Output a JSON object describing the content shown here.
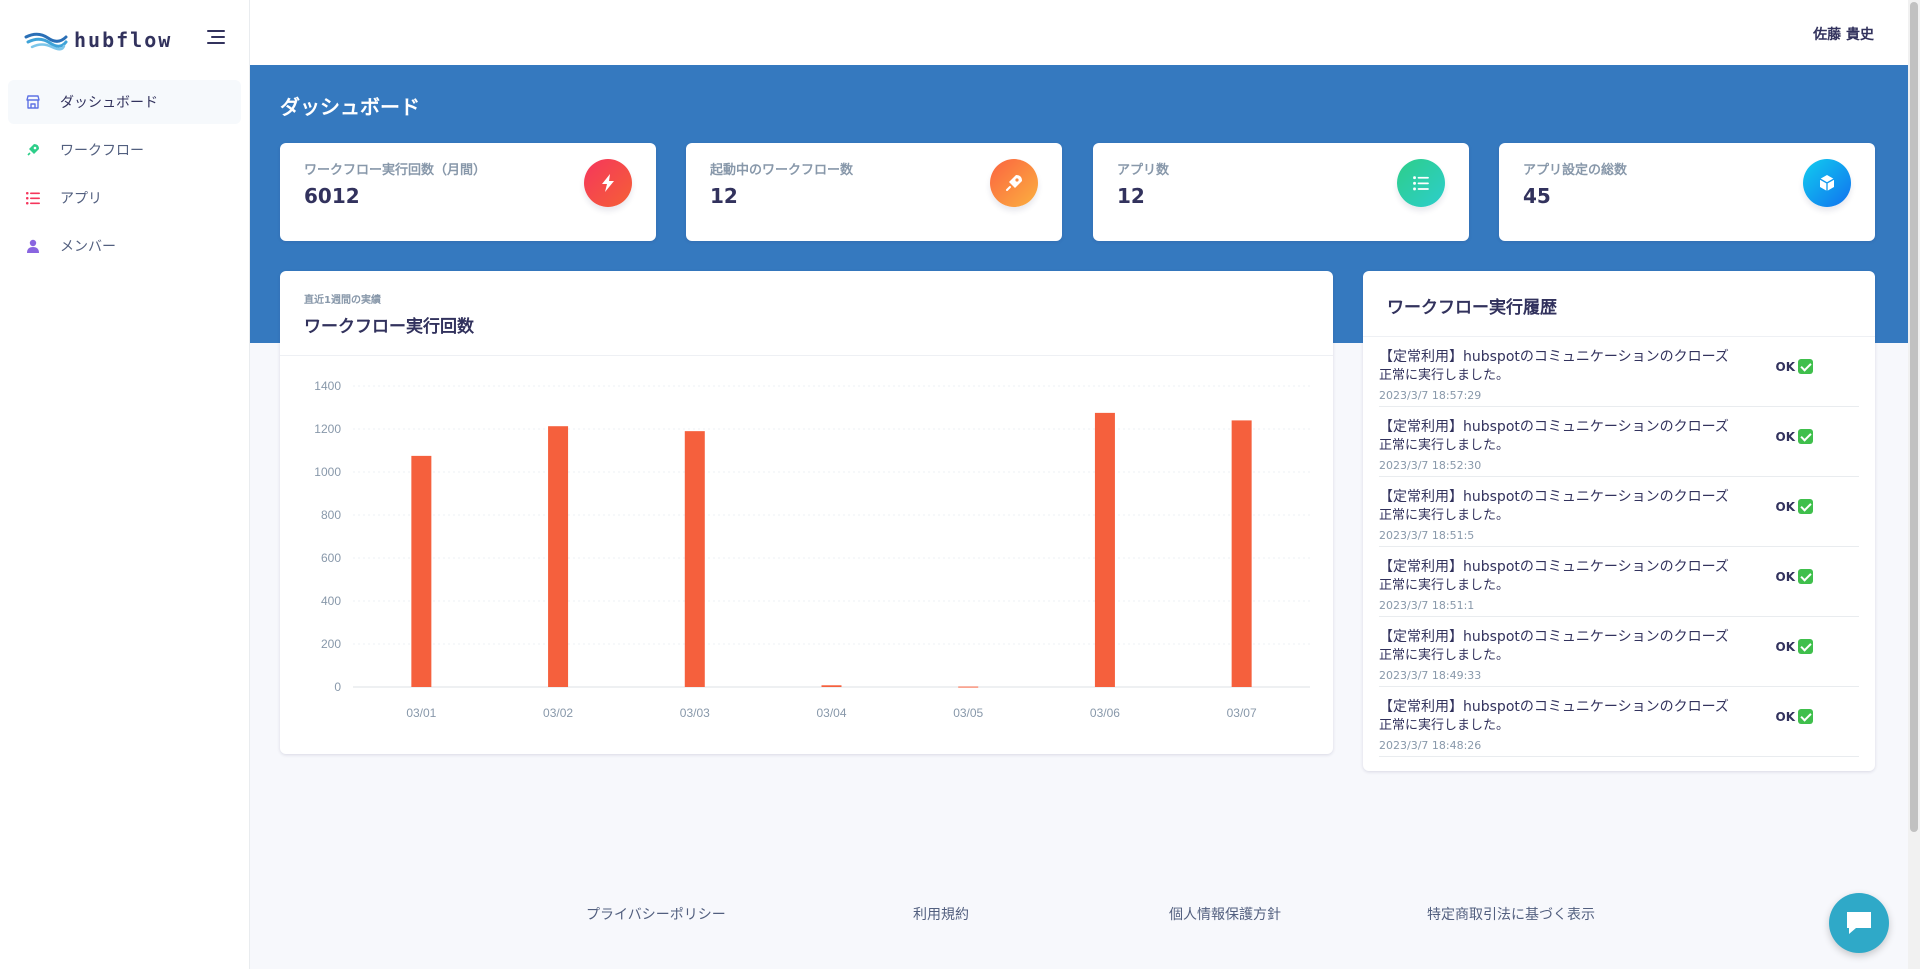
{
  "brand": {
    "name": "hubflow"
  },
  "sidebar": {
    "items": [
      {
        "label": "ダッシュボード",
        "icon": "store-icon",
        "active": true
      },
      {
        "label": "ワークフロー",
        "icon": "rocket-icon",
        "active": false
      },
      {
        "label": "アプリ",
        "icon": "list-icon",
        "active": false
      },
      {
        "label": "メンバー",
        "icon": "user-icon",
        "active": false
      }
    ]
  },
  "header": {
    "user_name": "佐藤 貴史"
  },
  "page": {
    "title": "ダッシュボード"
  },
  "stats": [
    {
      "label": "ワークフロー実行回数（月間）",
      "value": "6012",
      "icon": "bolt-icon",
      "color": "#f5365c"
    },
    {
      "label": "起動中のワークフロー数",
      "value": "12",
      "icon": "rocket-icon",
      "color": "#fb6340"
    },
    {
      "label": "アプリ数",
      "value": "12",
      "icon": "list-icon",
      "color": "#2dce89"
    },
    {
      "label": "アプリ設定の総数",
      "value": "45",
      "icon": "box-icon",
      "color": "#11cdef"
    }
  ],
  "chart_card": {
    "subtitle": "直近1週間の実績",
    "title": "ワークフロー実行回数"
  },
  "chart_data": {
    "type": "bar",
    "categories": [
      "03/01",
      "03/02",
      "03/03",
      "03/04",
      "03/05",
      "03/06",
      "03/07"
    ],
    "values": [
      1075,
      1213,
      1190,
      8,
      2,
      1275,
      1240
    ],
    "ylim": [
      0,
      1400
    ],
    "yticks": [
      0,
      200,
      400,
      600,
      800,
      1000,
      1200,
      1400
    ],
    "grid": true,
    "color": "#f5603d"
  },
  "history": {
    "title": "ワークフロー実行履歴",
    "items": [
      {
        "title": "【定常利用】hubspotのコミュニケーションのクローズ",
        "message": "正常に実行しました。",
        "time": "2023/3/7 18:57:29",
        "status": "OK"
      },
      {
        "title": "【定常利用】hubspotのコミュニケーションのクローズ",
        "message": "正常に実行しました。",
        "time": "2023/3/7 18:52:30",
        "status": "OK"
      },
      {
        "title": "【定常利用】hubspotのコミュニケーションのクローズ",
        "message": "正常に実行しました。",
        "time": "2023/3/7 18:51:5",
        "status": "OK"
      },
      {
        "title": "【定常利用】hubspotのコミュニケーションのクローズ",
        "message": "正常に実行しました。",
        "time": "2023/3/7 18:51:1",
        "status": "OK"
      },
      {
        "title": "【定常利用】hubspotのコミュニケーションのクローズ",
        "message": "正常に実行しました。",
        "time": "2023/3/7 18:49:33",
        "status": "OK"
      },
      {
        "title": "【定常利用】hubspotのコミュニケーションのクローズ",
        "message": "正常に実行しました。",
        "time": "2023/3/7 18:48:26",
        "status": "OK"
      }
    ]
  },
  "footer": {
    "links": [
      "プライバシーポリシー",
      "利用規約",
      "個人情報保護方針",
      "特定商取引法に基づく表示"
    ]
  },
  "colors": {
    "primary_band": "#3579bf",
    "chat_button": "#2fa9c8"
  }
}
